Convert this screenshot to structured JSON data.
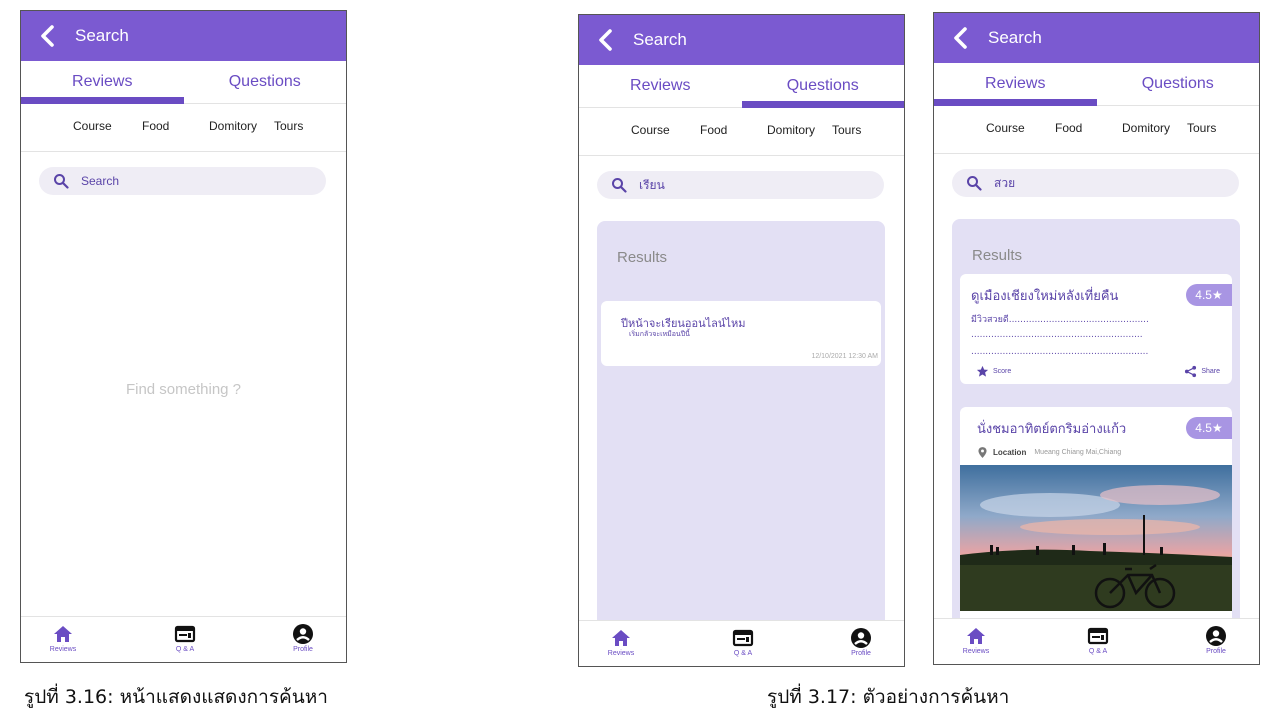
{
  "screens": [
    {
      "app_title": "Search",
      "tabs": [
        "Reviews",
        "Questions"
      ],
      "active_tab": "Reviews",
      "categories": [
        "Course",
        "Food",
        "Domitory",
        "Tours"
      ],
      "search_value": "Search",
      "empty_message": "Find something ?",
      "nav": [
        "Reviews",
        "Q & A",
        "Profile"
      ]
    },
    {
      "app_title": "Search",
      "tabs": [
        "Reviews",
        "Questions"
      ],
      "active_tab": "Questions",
      "categories": [
        "Course",
        "Food",
        "Domitory",
        "Tours"
      ],
      "search_value": "เรียน",
      "results_title": "Results",
      "question": {
        "title": "ปีหน้าจะเรียนออนไลน์ไหม",
        "subtitle": "เริ่มกลัวจะเหมือนปีนี้",
        "date": "12/10/2021  12:30 AM"
      },
      "nav": [
        "Reviews",
        "Q & A",
        "Profile"
      ]
    },
    {
      "app_title": "Search",
      "tabs": [
        "Reviews",
        "Questions"
      ],
      "active_tab": "Reviews",
      "categories": [
        "Course",
        "Food",
        "Domitory",
        "Tours"
      ],
      "search_value": "สวย",
      "results_title": "Results",
      "review1": {
        "title": "ดูเมืองเชียงใหม่หลังเที่ยคืน",
        "rating": "4.5★",
        "line1": "มีวิวสวยดี.................................................",
        "line2": "............................................................",
        "line3": "..............................................................",
        "score_label": "Score",
        "share_label": "Share"
      },
      "review2": {
        "title": "นั่งชมอาทิตย์ตกริมอ่างแก้ว",
        "rating": "4.5★",
        "location_label": "Location",
        "location_value": "Mueang Chiang Mai,Chiang"
      },
      "nav": [
        "Reviews",
        "Q & A",
        "Profile"
      ]
    }
  ],
  "captions": [
    "รูปที่ 3.16: หน้าแสดงแสดงการค้นหา",
    "รูปที่ 3.17: ตัวอย่างการค้นหา"
  ],
  "colors": {
    "primary": "#7b5ad1",
    "accent_text": "#6a4cc3",
    "results_bg": "#e3e0f4",
    "rating_badge": "#a895e3"
  },
  "icons": [
    "back-arrow-icon",
    "search-icon",
    "home-icon",
    "qa-board-icon",
    "profile-icon",
    "star-icon",
    "share-icon",
    "location-pin-icon"
  ]
}
